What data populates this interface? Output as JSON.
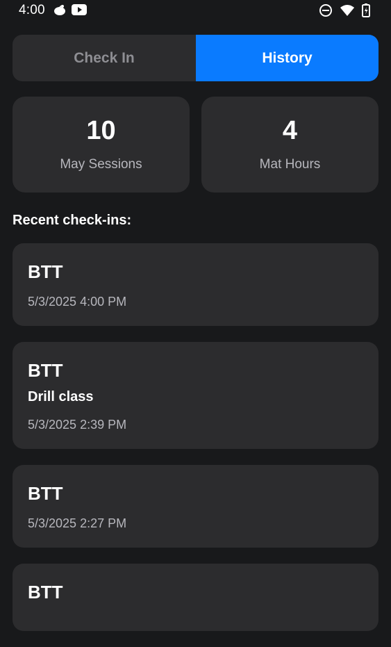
{
  "status_bar": {
    "time": "4:00",
    "left_icons": [
      "notification-cloud-icon",
      "youtube-icon"
    ],
    "right_icons": [
      "do-not-disturb-icon",
      "wifi-icon",
      "battery-icon"
    ]
  },
  "tabs": [
    {
      "label": "Check In",
      "selected": false
    },
    {
      "label": "History",
      "selected": true
    }
  ],
  "stats": [
    {
      "value": "10",
      "label": "May Sessions"
    },
    {
      "value": "4",
      "label": "Mat Hours"
    }
  ],
  "section_title": "Recent check-ins:",
  "checkins": [
    {
      "gym": "BTT",
      "note": "",
      "time": "5/3/2025 4:00 PM"
    },
    {
      "gym": "BTT",
      "note": "Drill class",
      "time": "5/3/2025 2:39 PM"
    },
    {
      "gym": "BTT",
      "note": "",
      "time": "5/3/2025 2:27 PM"
    },
    {
      "gym": "BTT",
      "note": "",
      "time": ""
    }
  ],
  "colors": {
    "background": "#18191b",
    "card": "#2c2c2e",
    "accent": "#0a7bff",
    "muted_text": "#b7b7bd"
  }
}
